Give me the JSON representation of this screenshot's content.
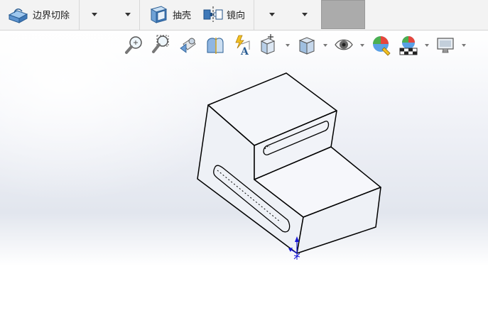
{
  "toolbar": {
    "boundary_cut_label": "边界切除",
    "shell_label": "抽壳",
    "mirror_label": "镜向",
    "swatch_color": "#ababab"
  },
  "viewport": {
    "background_top": "#ffffff",
    "background_mid": "#e2e6ee",
    "model_edge_color": "#000000",
    "triad_color": "#1515d8"
  },
  "heads_up_toolbar": {
    "icons": [
      "zoom-to-fit-icon",
      "zoom-to-area-icon",
      "previous-view-icon",
      "section-view-icon",
      "dynamic-annotation-icon",
      "view-orientation-icon",
      "display-style-icon",
      "hide-show-items-icon",
      "edit-appearance-icon",
      "apply-scene-icon",
      "view-settings-icon"
    ]
  }
}
